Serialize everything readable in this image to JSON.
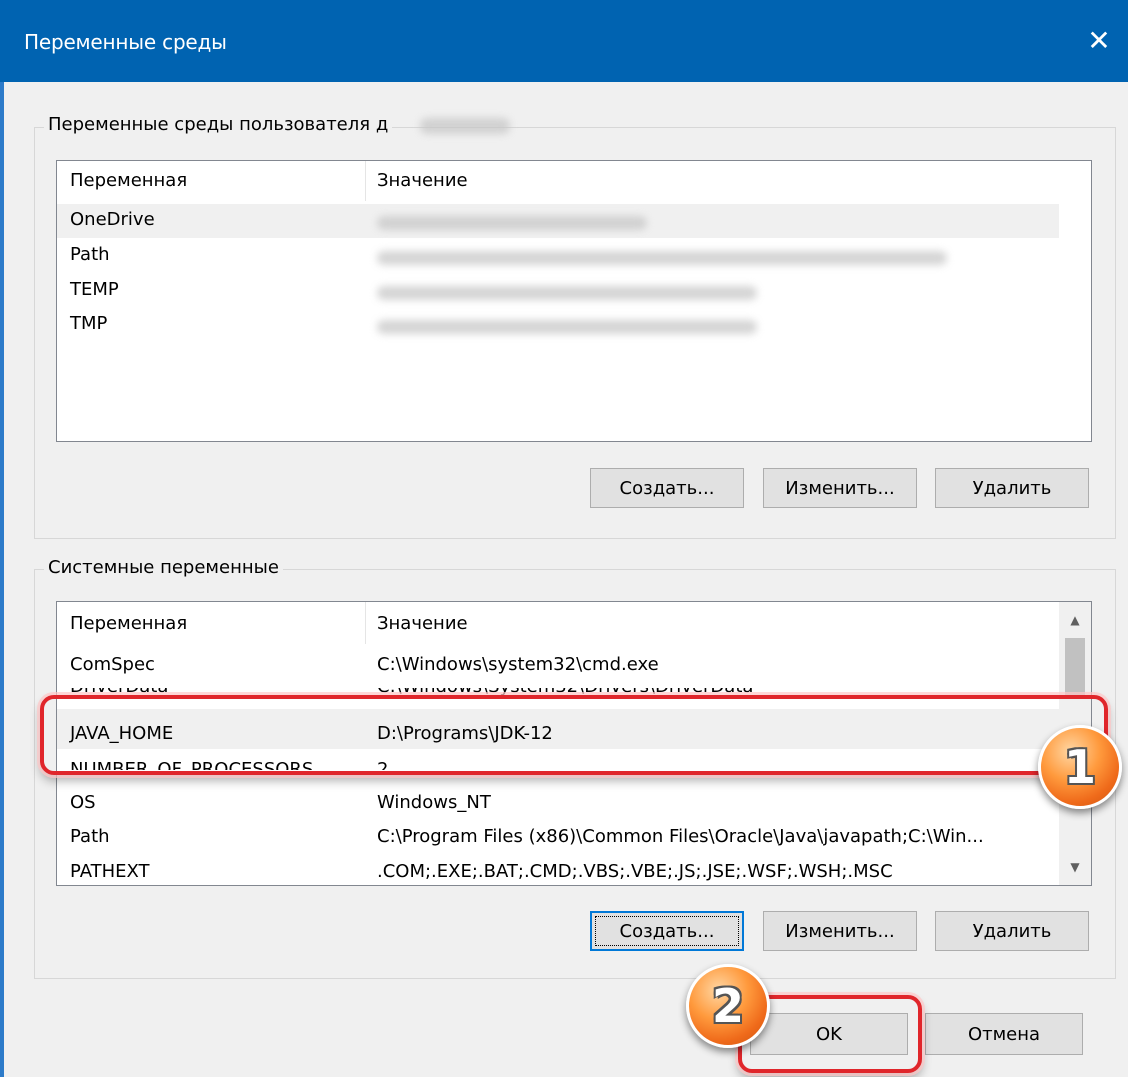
{
  "window": {
    "title": "Переменные среды",
    "close_glyph": "✕"
  },
  "user_vars": {
    "group_label": "Переменные среды пользователя д",
    "col_name": "Переменная",
    "col_value": "Значение",
    "rows": [
      {
        "name": "OneDrive"
      },
      {
        "name": "Path"
      },
      {
        "name": "TEMP"
      },
      {
        "name": "TMP"
      }
    ],
    "buttons": {
      "new": "Создать...",
      "edit": "Изменить...",
      "delete": "Удалить"
    }
  },
  "system_vars": {
    "group_label": "Системные переменные",
    "col_name": "Переменная",
    "col_value": "Значение",
    "rows": [
      {
        "name": "ComSpec",
        "value": "C:\\Windows\\system32\\cmd.exe"
      },
      {
        "name": "DriverData",
        "value": "C:\\Windows\\System32\\Drivers\\DriverData"
      },
      {
        "name": "JAVA_HOME",
        "value": "D:\\Programs\\JDK-12"
      },
      {
        "name": "NUMBER_OF_PROCESSORS",
        "value": "2"
      },
      {
        "name": "OS",
        "value": "Windows_NT"
      },
      {
        "name": "Path",
        "value": "C:\\Program Files (x86)\\Common Files\\Oracle\\Java\\javapath;C:\\Win..."
      },
      {
        "name": "PATHEXT",
        "value": ".COM;.EXE;.BAT;.CMD;.VBS;.VBE;.JS;.JSE;.WSF;.WSH;.MSC"
      }
    ],
    "buttons": {
      "new": "Создать...",
      "edit": "Изменить...",
      "delete": "Удалить"
    }
  },
  "dialog_buttons": {
    "ok": "OK",
    "cancel": "Отмена"
  },
  "annotations": {
    "badge1": "1",
    "badge2": "2",
    "highlight_color": "#e0262b",
    "badge_color": "#ef6a1a"
  },
  "colors": {
    "titlebar": "#0063b1",
    "window_bg": "#f0f0f0"
  }
}
